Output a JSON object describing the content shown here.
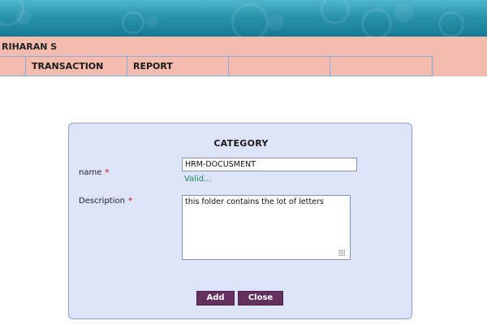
{
  "header": {
    "user_name": "RIHARAN S"
  },
  "menu": {
    "items": [
      {
        "label": ""
      },
      {
        "label": "TRANSACTION"
      },
      {
        "label": "REPORT"
      },
      {
        "label": ""
      },
      {
        "label": ""
      }
    ]
  },
  "dialog": {
    "title": "CATEGORY",
    "name_label": "name",
    "name_value": "HRM-DOCUSMENT",
    "validation_text": "Valid...",
    "description_label": "Description",
    "description_value": "this folder contains the lot of letters",
    "required_marker": "*",
    "add_label": "Add",
    "close_label": "Close"
  },
  "colors": {
    "banner": "#2a94ad",
    "menu_bg": "#f3bcae",
    "dialog_bg": "#dde3f8",
    "button_bg": "#62315e",
    "valid_text": "#1e8a5a",
    "required": "#cc0000"
  }
}
